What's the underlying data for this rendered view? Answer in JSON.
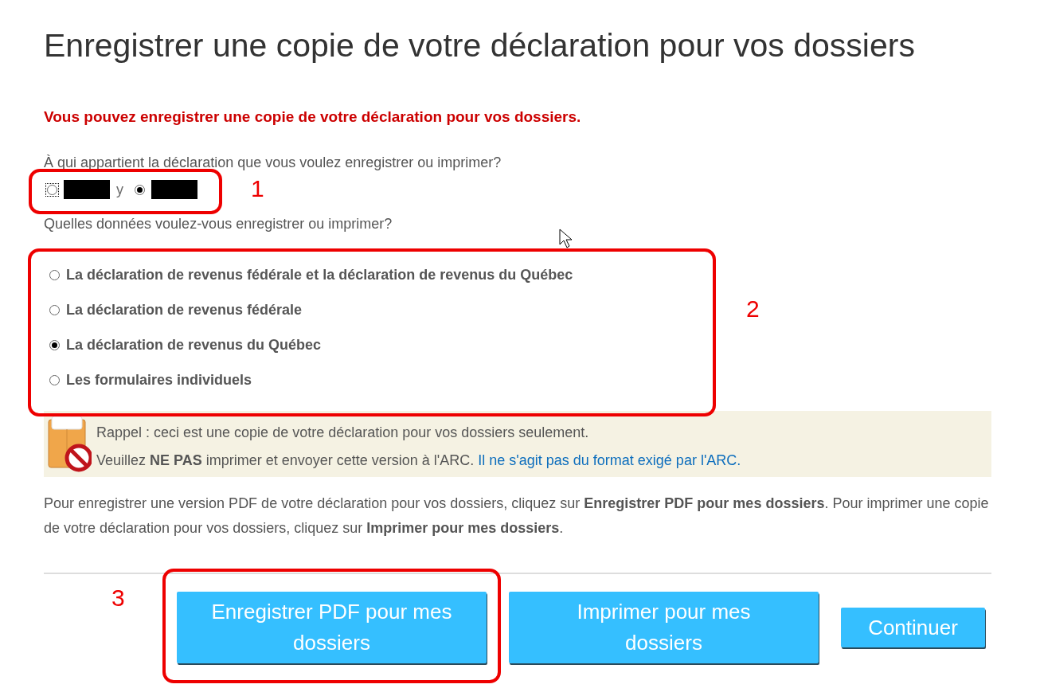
{
  "title": "Enregistrer une copie de votre déclaration pour vos dossiers",
  "intro": "Vous pouvez enregistrer une copie de votre déclaration pour vos dossiers.",
  "owner_question": "À qui appartient la déclaration que vous voulez enregistrer ou imprimer?",
  "owners": [
    {
      "redacted": true,
      "tail": "y",
      "selected": false,
      "focused": true
    },
    {
      "redacted": true,
      "selected": true,
      "focused": false
    }
  ],
  "data_question": "Quelles données voulez-vous enregistrer ou imprimer?",
  "data_options": [
    {
      "label": "La déclaration de revenus fédérale et la déclaration de revenus du Québec",
      "selected": false
    },
    {
      "label": "La déclaration de revenus fédérale",
      "selected": false
    },
    {
      "label": "La déclaration de revenus du Québec",
      "selected": true
    },
    {
      "label": "Les formulaires individuels",
      "selected": false
    }
  ],
  "notice": {
    "line_1": "Rappel : ceci est une copie de votre déclaration pour vos dossiers seulement.",
    "line_2": "Veuillez **NE PAS** imprimer et envoyer cette version à l'ARC.",
    "link": "Il ne s'agit pas du format exigé par l'ARC."
  },
  "instructions": "Pour enregistrer une version PDF de votre déclaration pour vos dossiers, cliquez sur **Enregistrer PDF pour mes dossiers**. Pour imprimer une copie de votre déclaration pour vos dossiers, cliquez sur **Imprimer pour mes dossiers**.",
  "buttons": [
    {
      "label": "Enregistrer PDF pour mes dossiers",
      "kind": "large"
    },
    {
      "label": "Imprimer pour mes dossiers",
      "kind": "large"
    },
    {
      "label": "Continuer",
      "kind": "small"
    }
  ],
  "annotations": [
    {
      "number": "1"
    },
    {
      "number": "2"
    },
    {
      "number": "3"
    }
  ]
}
